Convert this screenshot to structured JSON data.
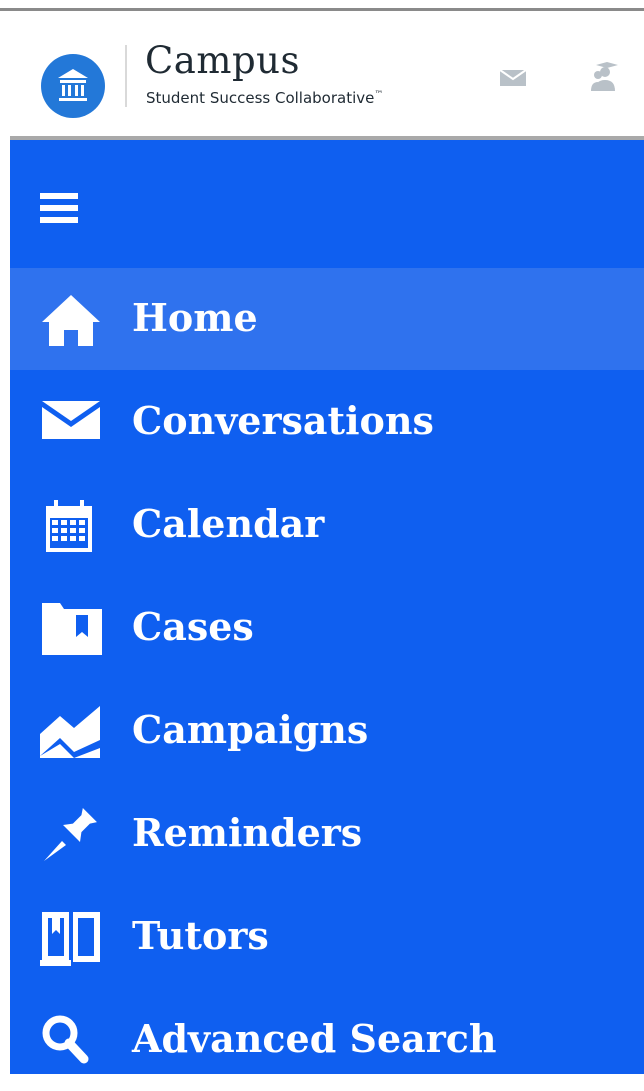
{
  "brand": {
    "title": "Campus",
    "subtitle": "Student Success Collaborative",
    "trademark": "™"
  },
  "header_icons": [
    "mail-icon",
    "students-icon"
  ],
  "menu_icon": "hamburger-menu-icon",
  "nav": {
    "items": [
      {
        "label": "Home",
        "icon": "home-icon",
        "active": true
      },
      {
        "label": "Conversations",
        "icon": "envelope-icon",
        "active": false
      },
      {
        "label": "Calendar",
        "icon": "calendar-icon",
        "active": false
      },
      {
        "label": "Cases",
        "icon": "folder-icon",
        "active": false
      },
      {
        "label": "Campaigns",
        "icon": "chart-icon",
        "active": false
      },
      {
        "label": "Reminders",
        "icon": "pushpin-icon",
        "active": false
      },
      {
        "label": "Tutors",
        "icon": "book-icon",
        "active": false
      },
      {
        "label": "Advanced Search",
        "icon": "search-icon",
        "active": false
      }
    ]
  },
  "colors": {
    "sidebar_bg": "#0f5ff0",
    "active_bg": "#2f72ee",
    "logo_blue": "#2378d8",
    "text_dark": "#1f2a33"
  }
}
